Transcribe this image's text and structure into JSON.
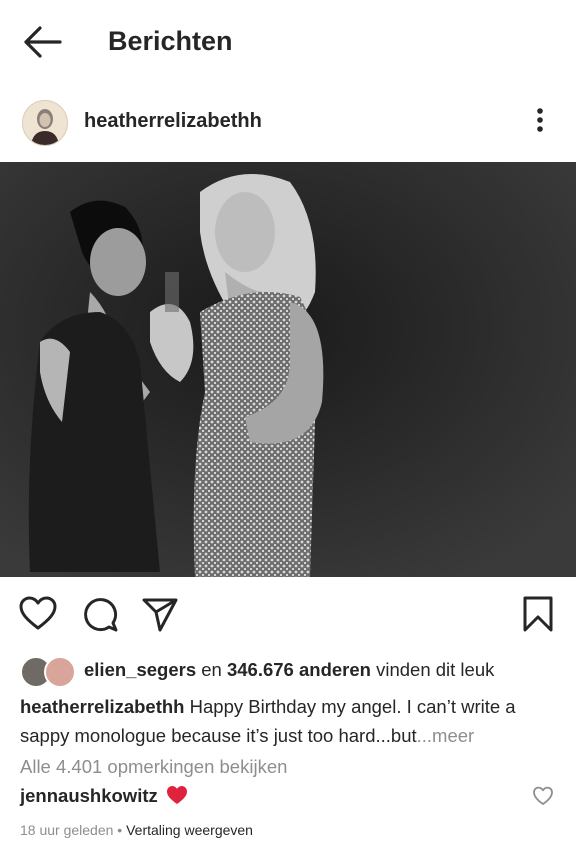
{
  "header": {
    "title": "Berichten",
    "back_icon": "arrow-left-icon"
  },
  "post": {
    "username": "heatherrelizabethh",
    "more_icon": "vertical-dots-icon",
    "image_description_icon": "photo"
  },
  "actions": {
    "like_icon": "heart-icon",
    "comment_icon": "comment-icon",
    "share_icon": "send-icon",
    "save_icon": "bookmark-icon"
  },
  "likes": {
    "first_liker": "elien_segers",
    "connector": " en ",
    "others": "346.676 anderen",
    "suffix": " vinden dit leuk"
  },
  "caption": {
    "username": "heatherrelizabethh",
    "text": " Happy Birthday my angel. I can’t write a sappy monologue because it’s just too hard...but",
    "more": "...meer"
  },
  "comments": {
    "view_all": "Alle 4.401 opmerkingen bekijken",
    "first": {
      "username": "jennaushkowitz",
      "emoji": "red-heart"
    }
  },
  "meta": {
    "time": "18 uur geleden",
    "separator": " • ",
    "translate": "Vertaling weergeven"
  },
  "colors": {
    "text": "#262626",
    "muted": "#8e8e8e",
    "heart": "#ed4956",
    "photo_bg": "#343434"
  }
}
